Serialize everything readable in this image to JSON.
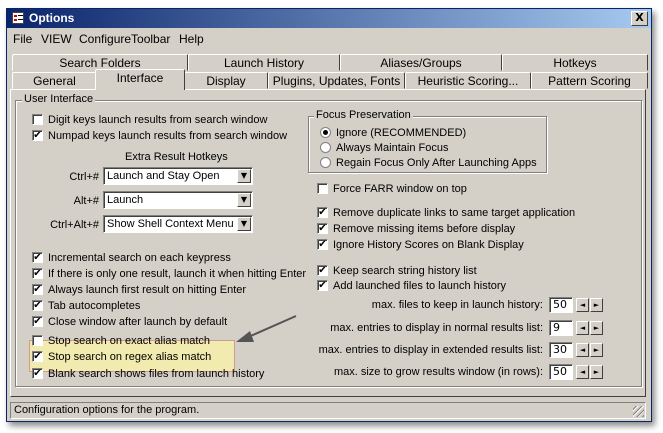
{
  "window": {
    "title": "Options",
    "close_symbol": "X"
  },
  "menu": [
    "File",
    "VIEW",
    "ConfigureToolbar",
    "Help"
  ],
  "tabs_row1": [
    "Search Folders",
    "Launch History",
    "Aliases/Groups",
    "Hotkeys"
  ],
  "tabs_row2": [
    "General",
    "Interface",
    "Display",
    "Plugins, Updates, Fonts",
    "Heuristic Scoring...",
    "Pattern Scoring"
  ],
  "active_tab": "Interface",
  "ui_group": {
    "label": "User Interface"
  },
  "left_top": [
    {
      "label": "Digit keys launch results from search window",
      "checked": false
    },
    {
      "label": "Numpad keys launch results from search window",
      "checked": true
    }
  ],
  "extra_hotkeys": {
    "heading": "Extra Result Hotkeys",
    "rows": [
      {
        "key": "Ctrl+#",
        "value": "Launch and Stay Open"
      },
      {
        "key": "Alt+#",
        "value": "Launch"
      },
      {
        "key": "Ctrl+Alt+#",
        "value": "Show Shell Context Menu"
      }
    ]
  },
  "left_bottom": [
    {
      "label": "Incremental search on each keypress",
      "checked": true
    },
    {
      "label": "If there is only one result, launch it when hitting Enter",
      "checked": true
    },
    {
      "label": "Always launch first result on hitting Enter",
      "checked": true
    },
    {
      "label": "Tab autocompletes",
      "checked": true
    },
    {
      "label": "Close window after launch by default",
      "checked": true
    },
    {
      "label": "Stop search on exact alias match",
      "checked": false
    },
    {
      "label": "Stop search on regex alias match",
      "checked": true
    },
    {
      "label": "Blank search shows files from launch history",
      "checked": true
    }
  ],
  "focus": {
    "label": "Focus Preservation",
    "options": [
      {
        "label": "Ignore (RECOMMENDED)",
        "selected": true
      },
      {
        "label": "Always Maintain Focus",
        "selected": false
      },
      {
        "label": "Regain Focus Only After Launching Apps",
        "selected": false
      }
    ]
  },
  "right_checks_a": [
    {
      "label": "Force FARR window on top",
      "checked": false
    }
  ],
  "right_checks_b": [
    {
      "label": "Remove duplicate links to same target application",
      "checked": true
    },
    {
      "label": "Remove missing items before display",
      "checked": true
    },
    {
      "label": "Ignore History Scores on Blank Display",
      "checked": true
    }
  ],
  "right_checks_c": [
    {
      "label": "Keep search string history list",
      "checked": true
    },
    {
      "label": "Add launched files to launch history",
      "checked": true
    }
  ],
  "numeric": [
    {
      "label": "max. files to keep in launch history:",
      "value": "50"
    },
    {
      "label": "max. entries to display in normal results list:",
      "value": "9"
    },
    {
      "label": "max. entries to display in extended results list:",
      "value": "30"
    },
    {
      "label": "max. size to grow results window (in rows):",
      "value": "50"
    }
  ],
  "status": "Configuration options for the program.",
  "colors": {
    "arrow": "#555555",
    "highlight_fill": "#f1ebb0",
    "highlight_border": "#d49a8e"
  }
}
